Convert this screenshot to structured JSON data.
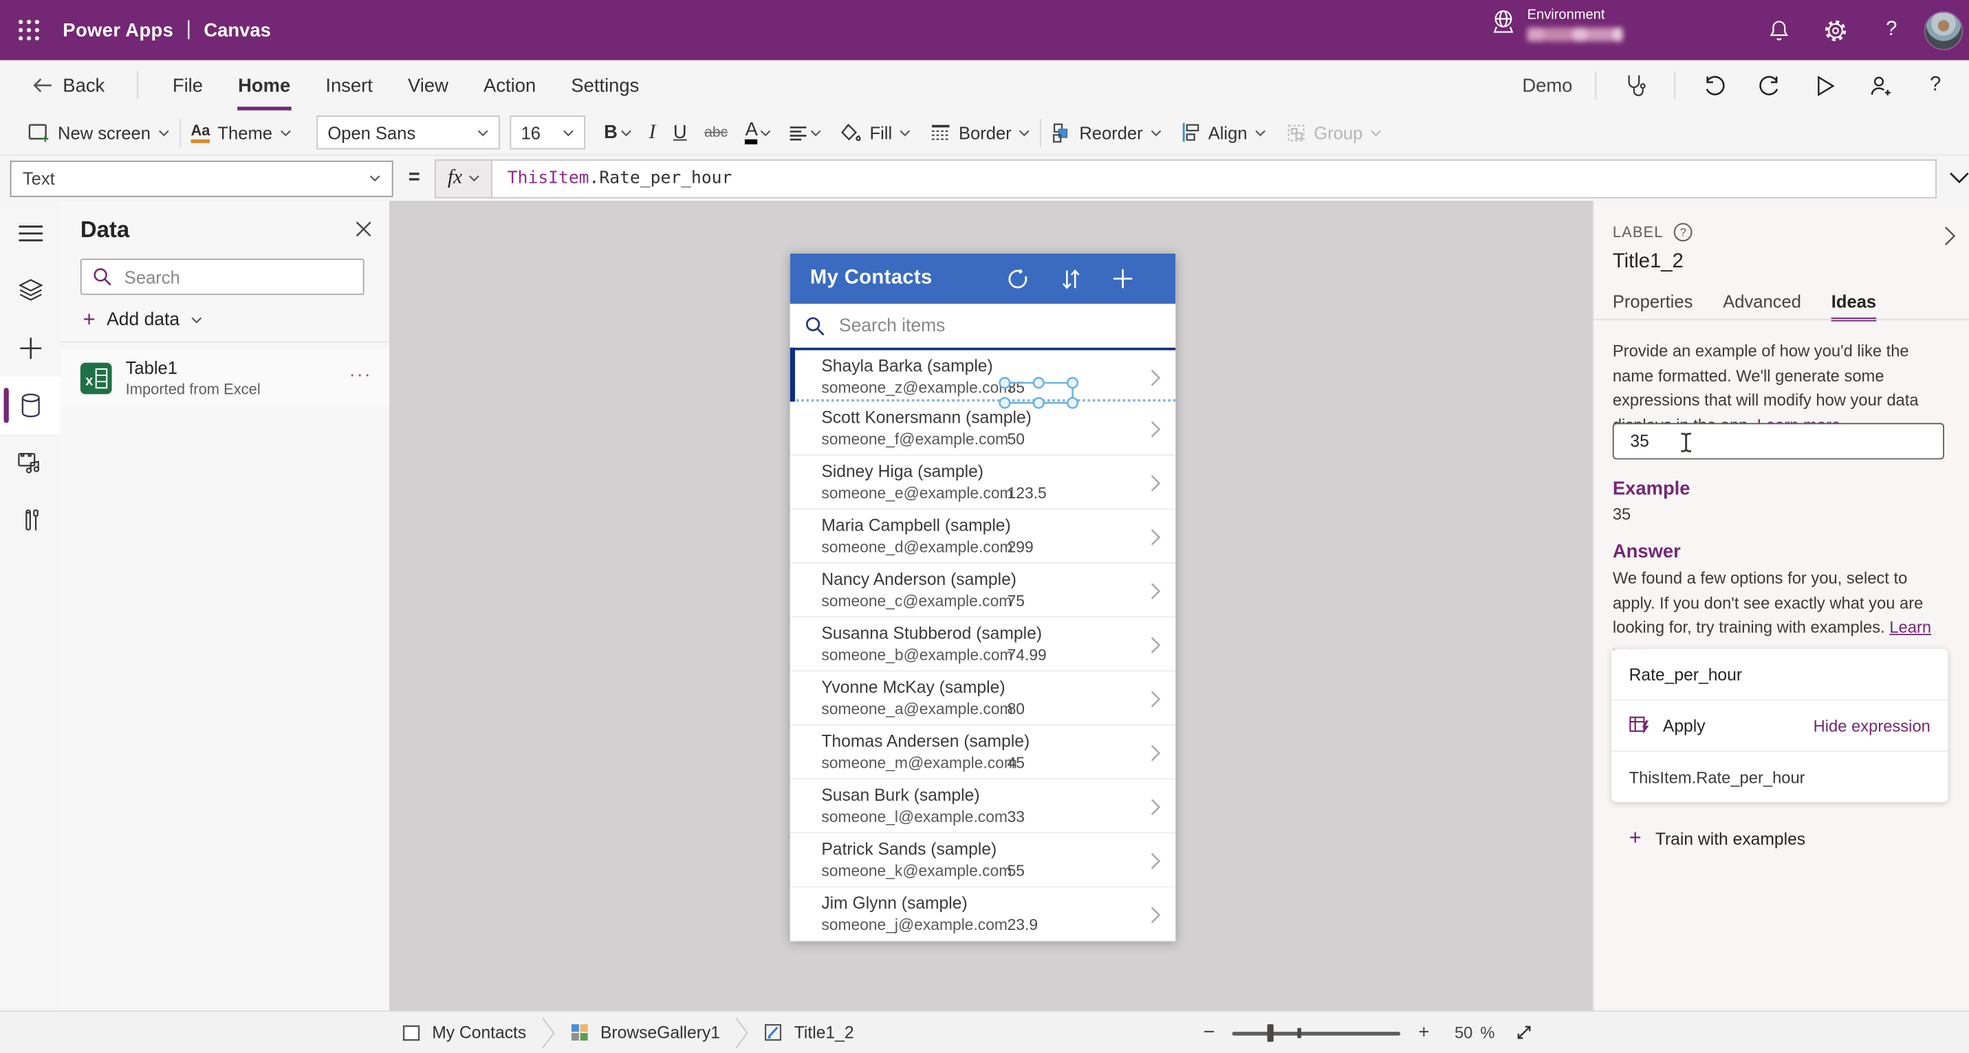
{
  "app_header": {
    "brand": "Power Apps",
    "divider": "|",
    "app_type": "Canvas",
    "environment_label": "Environment",
    "help": "?"
  },
  "menu_bar": {
    "back": "Back",
    "file": "File",
    "home": "Home",
    "insert": "Insert",
    "view": "View",
    "action": "Action",
    "settings": "Settings",
    "app_name": "Demo",
    "help": "?"
  },
  "toolbar": {
    "new_screen": "New screen",
    "theme": "Theme",
    "theme_glyph": "Aa",
    "font_name": "Open Sans",
    "font_size": "16",
    "bold": "B",
    "italic": "I",
    "underline": "U",
    "strikethrough": "abc",
    "font_color": "A",
    "fill": "Fill",
    "border": "Border",
    "reorder": "Reorder",
    "align": "Align",
    "group": "Group"
  },
  "formula_bar": {
    "property": "Text",
    "equals": "=",
    "fx": "fx",
    "expr_object": "ThisItem",
    "expr_rest": ".Rate_per_hour"
  },
  "data_panel": {
    "title": "Data",
    "search_placeholder": "Search",
    "plus": "+",
    "add_data": "Add data",
    "table_name": "Table1",
    "table_source": "Imported from Excel",
    "more": "···"
  },
  "gallery": {
    "title": "My Contacts",
    "search_placeholder": "Search items",
    "rows": [
      {
        "name": "Shayla Barka (sample)",
        "email": "someone_z@example.com",
        "rate": "35"
      },
      {
        "name": "Scott Konersmann (sample)",
        "email": "someone_f@example.com",
        "rate": "50"
      },
      {
        "name": "Sidney Higa (sample)",
        "email": "someone_e@example.com",
        "rate": "123.5"
      },
      {
        "name": "Maria Campbell (sample)",
        "email": "someone_d@example.com",
        "rate": "299"
      },
      {
        "name": "Nancy Anderson (sample)",
        "email": "someone_c@example.com",
        "rate": "75"
      },
      {
        "name": "Susanna Stubberod (sample)",
        "email": "someone_b@example.com",
        "rate": "74.99"
      },
      {
        "name": "Yvonne McKay (sample)",
        "email": "someone_a@example.com",
        "rate": "80"
      },
      {
        "name": "Thomas Andersen (sample)",
        "email": "someone_m@example.com",
        "rate": "45"
      },
      {
        "name": "Susan Burk (sample)",
        "email": "someone_l@example.com",
        "rate": "33"
      },
      {
        "name": "Patrick Sands (sample)",
        "email": "someone_k@example.com",
        "rate": "55"
      },
      {
        "name": "Jim Glynn (sample)",
        "email": "someone_j@example.com",
        "rate": "23.9"
      }
    ]
  },
  "right_panel": {
    "control_type": "LABEL",
    "help": "?",
    "control_name": "Title1_2",
    "tab_properties": "Properties",
    "tab_advanced": "Advanced",
    "tab_ideas": "Ideas",
    "intro": "Provide an example of how you'd like the name formatted. We'll generate some expressions that will modify how your data displays in the app.",
    "learn_more": "Learn more",
    "input_value": "35",
    "example_heading": "Example",
    "example_value": "35",
    "answer_heading": "Answer",
    "answer_text": "We found a few options for you, select to apply. If you don't see exactly what you are looking for, try training with examples.",
    "answer_learn_more": "Learn more",
    "suggestion_field": "Rate_per_hour",
    "apply": "Apply",
    "hide_expression": "Hide expression",
    "expression": "ThisItem.Rate_per_hour",
    "train_plus": "+",
    "train": "Train with examples"
  },
  "bottom_bar": {
    "screen": "My Contacts",
    "gallery": "BrowseGallery1",
    "control": "Title1_2",
    "minus": "−",
    "plus": "+",
    "zoom_value": "50",
    "zoom_unit": "%"
  },
  "colors": {
    "brand_purple": "#742774",
    "gallery_header_blue": "#3a6bc0",
    "selection_navy": "#0b2d86",
    "handle_blue": "#6cb2e3",
    "excel_green": "#1e7145"
  }
}
